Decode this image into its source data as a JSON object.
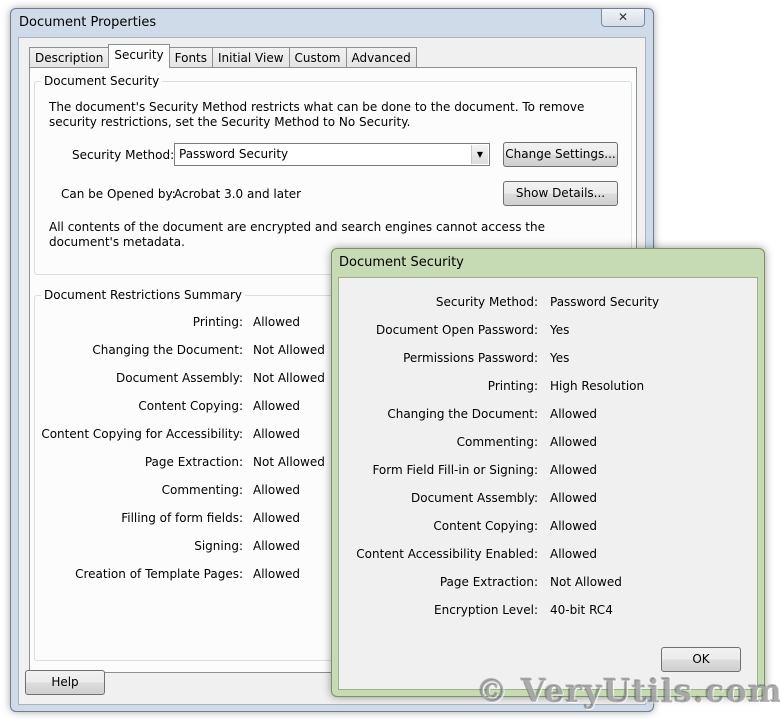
{
  "main_window": {
    "title": "Document Properties",
    "close_label": "✕",
    "tabs": [
      {
        "label": "Description",
        "active": false
      },
      {
        "label": "Security",
        "active": true
      },
      {
        "label": "Fonts",
        "active": false
      },
      {
        "label": "Initial View",
        "active": false
      },
      {
        "label": "Custom",
        "active": false
      },
      {
        "label": "Advanced",
        "active": false
      }
    ],
    "help_label": "Help"
  },
  "document_security": {
    "legend": "Document Security",
    "intro": "The document's Security Method restricts what can be done to the document. To remove security restrictions, set the Security Method to No Security.",
    "method_label": "Security Method:",
    "method_value": "Password Security",
    "change_settings_label": "Change Settings...",
    "opened_by_label": "Can be Opened by:",
    "opened_by_value": "Acrobat 3.0 and later",
    "show_details_label": "Show Details...",
    "encryption_note": "All contents of the document are encrypted and search engines cannot access the document's metadata."
  },
  "restrictions": {
    "legend": "Document Restrictions Summary",
    "rows": [
      {
        "label": "Printing:",
        "value": "Allowed"
      },
      {
        "label": "Changing the Document:",
        "value": "Not Allowed"
      },
      {
        "label": "Document Assembly:",
        "value": "Not Allowed"
      },
      {
        "label": "Content Copying:",
        "value": "Allowed"
      },
      {
        "label": "Content Copying for Accessibility:",
        "value": "Allowed"
      },
      {
        "label": "Page Extraction:",
        "value": "Not Allowed"
      },
      {
        "label": "Commenting:",
        "value": "Allowed"
      },
      {
        "label": "Filling of form fields:",
        "value": "Allowed"
      },
      {
        "label": "Signing:",
        "value": "Allowed"
      },
      {
        "label": "Creation of Template Pages:",
        "value": "Allowed"
      }
    ]
  },
  "security_dialog": {
    "title": "Document Security",
    "rows": [
      {
        "label": "Security Method:",
        "value": "Password Security"
      },
      {
        "label": "Document Open Password:",
        "value": "Yes"
      },
      {
        "label": "Permissions Password:",
        "value": "Yes"
      },
      {
        "label": "Printing:",
        "value": "High Resolution"
      },
      {
        "label": "Changing the Document:",
        "value": "Allowed"
      },
      {
        "label": "Commenting:",
        "value": "Allowed"
      },
      {
        "label": "Form Field Fill-in or Signing:",
        "value": "Allowed"
      },
      {
        "label": "Document Assembly:",
        "value": "Allowed"
      },
      {
        "label": "Content Copying:",
        "value": "Allowed"
      },
      {
        "label": "Content Accessibility Enabled:",
        "value": "Allowed"
      },
      {
        "label": "Page Extraction:",
        "value": "Not Allowed"
      },
      {
        "label": "Encryption Level:",
        "value": "40-bit RC4"
      }
    ],
    "ok_label": "OK"
  },
  "watermark": "© VeryUtils.com"
}
